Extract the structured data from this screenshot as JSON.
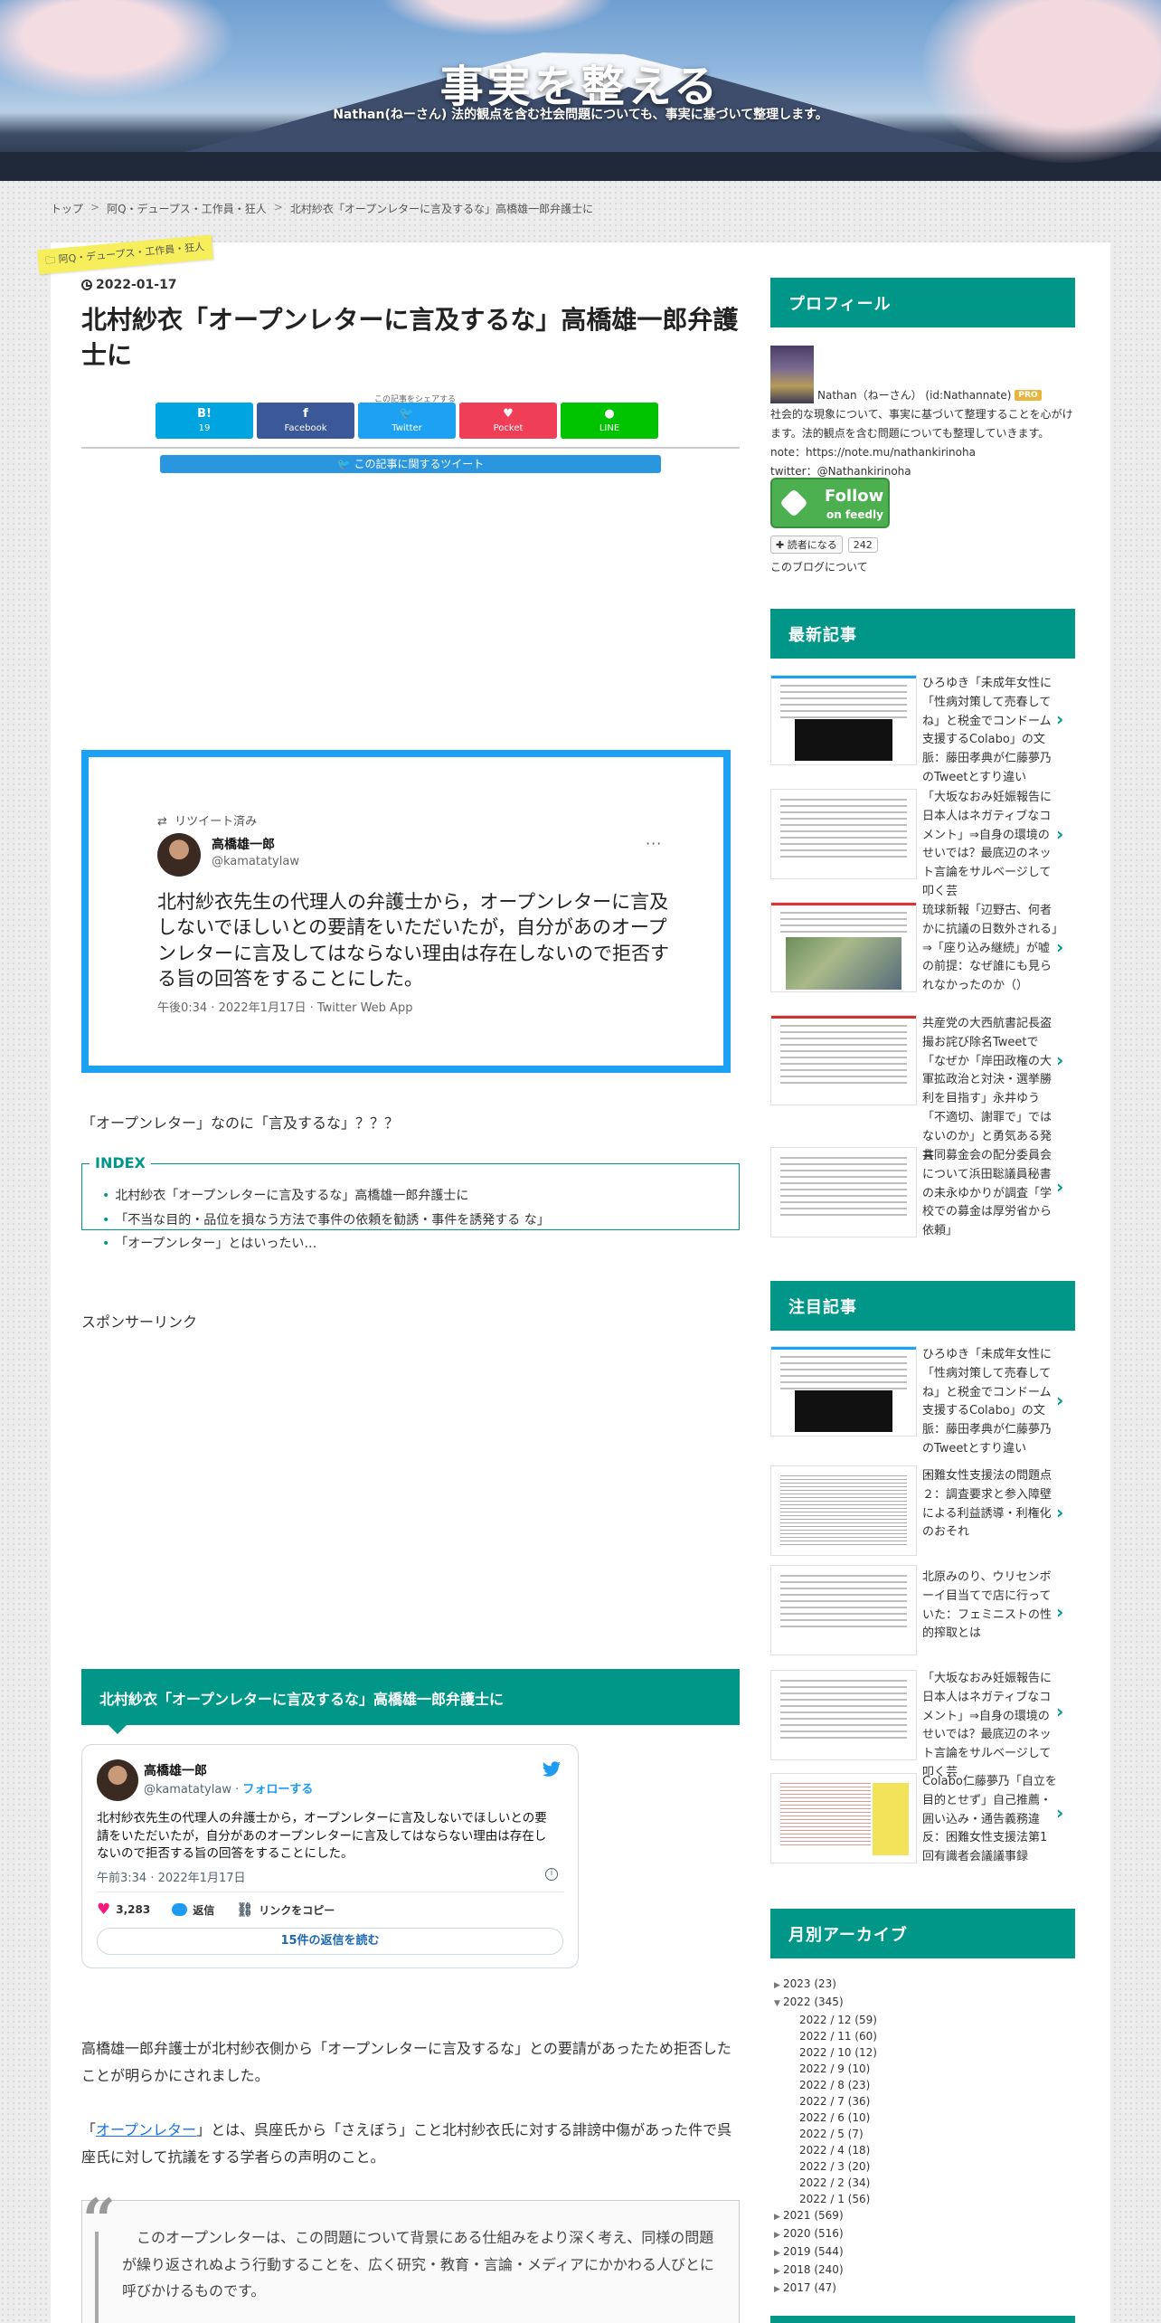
{
  "site": {
    "title": "事実を整える",
    "description": "Nathan(ねーさん) 法的観点を含む社会問題についても、事実に基づいて整理します。"
  },
  "breadcrumb": [
    "トップ",
    "阿Q・デュープス・工作員・狂人",
    "北村紗衣「オープンレターに言及するな」高橋雄一郎弁護士に"
  ],
  "post": {
    "category": "阿Q・デュープス・工作員・狂人",
    "date": "2022-01-17",
    "title": "北村紗衣「オープンレターに言及するな」高橋雄一郎弁護士に"
  },
  "share": {
    "caption": "この記事をシェアする",
    "buttons": [
      {
        "icon": "B!",
        "label": "19",
        "color": "#00a4de"
      },
      {
        "icon": "f",
        "label": "Facebook",
        "color": "#3b5998"
      },
      {
        "icon": "🐦",
        "label": "Twitter",
        "color": "#1da1f2"
      },
      {
        "icon": "♥",
        "label": "Pocket",
        "color": "#ef3f56"
      },
      {
        "icon": "●",
        "label": "LINE",
        "color": "#00c300"
      }
    ],
    "tweet_about": "この記事に関するツイート"
  },
  "tweet1": {
    "retweet": "リツイート済み",
    "name": "高橋雄一郎",
    "handle": "@kamatatylaw",
    "more": "···",
    "text": "北村紗衣先生の代理人の弁護士から，オープンレターに言及しないでほしいとの要請をいただいたが，自分があのオープンレターに言及してはならない理由は存在しないので拒否する旨の回答をすることにした。",
    "time": "午後0:34 · 2022年1月17日 · Twitter Web App"
  },
  "intro": "「オープンレター」なのに「言及するな」？？？",
  "index": {
    "title": "INDEX",
    "items": [
      "北村紗衣「オープンレターに言及するな」高橋雄一郎弁護士に",
      "「不当な目的・品位を損なう方法で事件の依頼を勧誘・事件を誘発する な」",
      "「オープンレター」とはいったい…"
    ]
  },
  "sponsor": "スポンサーリンク",
  "section1": "北村紗衣「オープンレターに言及するな」高橋雄一郎弁護士に",
  "embed": {
    "name": "高橋雄一郎",
    "handle": "@kamatatylaw",
    "follow": "フォローする",
    "text": "北村紗衣先生の代理人の弁護士から，オープンレターに言及しないでほしいとの要請をいただいたが，自分があのオープンレターに言及してはならない理由は存在しないので拒否する旨の回答をすることにした。",
    "time": "午前3:34 · 2022年1月17日",
    "likes": "3,283",
    "reply": "返信",
    "copy": "リンクをコピー",
    "replies": "15件の返信を読む"
  },
  "body": {
    "p1": "高橋雄一郎弁護士が北村紗衣側から「オープンレターに言及するな」との要請があったため拒否したことが明らかにされました。",
    "p2_pre": "「",
    "p2_link": "オープンレター",
    "p2_post": "」とは、呉座氏から「さえぼう」こと北村紗衣氏に対する誹謗中傷があった件で呉座氏に対して抗議をする学者らの声明のこと。",
    "quote": "このオープンレターは、この問題について背景にある仕組みをより深く考え、同様の問題が繰り返されぬよう行動することを、広く研究・教育・言論・メディアにかかわる人びとに呼びかけるものです。"
  },
  "sidebar": {
    "profile": {
      "head": "プロフィール",
      "name": "Nathan（ねーさん） (id:Nathannate)",
      "pro": "PRO",
      "bio": "社会的な現象について、事実に基づいて整理することを心がけます。法的観点を含む問題についても整理していきます。",
      "note": "note：https://note.mu/nathankirinoha",
      "twitter": "twitter：@Nathankirinoha",
      "feedly1": "Follow",
      "feedly2": "on feedly",
      "reader": "読者になる",
      "reader_count": "242",
      "about": "このブログについて"
    },
    "recent": {
      "head": "最新記事",
      "items": [
        "ひろゆき「未成年女性に「性病対策して売春してね」と税金でコンドーム支援するColabo」の文脈：藤田孝典が仁藤夢乃のTweetとすり違い",
        "「大坂なおみ妊娠報告に日本人はネガティブなコメント」⇒自身の環境のせいでは？最底辺のネット言論をサルベージして叩く芸",
        "琉球新報「辺野古、何者かに抗議の日数外される」⇒「座り込み継続」が嘘の前提：なぜ誰にも見られなかったのか（）",
        "共産党の大西航書記長盗撮お詫び除名Tweetで「なぜか「岸田政権の大軍拡政治と対決・選挙勝利を目指す」永井ゆう「不適切、謝罪で」ではないのか」と勇気ある発言",
        "共同募金会の配分委員会について浜田聡議員秘書の未永ゆかりが調査「学校での募金は厚労省から依頼」"
      ]
    },
    "featured": {
      "head": "注目記事",
      "items": [
        "ひろゆき「未成年女性に「性病対策して売春してね」と税金でコンドーム支援するColabo」の文脈：藤田孝典が仁藤夢乃のTweetとすり違い",
        "困難女性支援法の問題点２：調査要求と参入障壁による利益誘導・利権化のおそれ",
        "北原みのり、ウリセンボーイ目当てで店に行っていた：フェミニストの性的搾取とは",
        "「大坂なおみ妊娠報告に日本人はネガティブなコメント」⇒自身の環境のせいでは？最底辺のネット言論をサルベージして叩く芸",
        "Colabo仁藤夢乃「自立を目的とせず」自己推薦・囲い込み・通告義務違反：困難女性支援法第1回有識者会議議事録"
      ]
    },
    "archive": {
      "head": "月別アーカイブ",
      "years": [
        {
          "label": "2023 (23)",
          "open": false
        },
        {
          "label": "2022 (345)",
          "open": true
        }
      ],
      "months": [
        "2022 / 12 (59)",
        "2022 / 11 (60)",
        "2022 / 10 (12)",
        "2022 / 9 (10)",
        "2022 / 8 (23)",
        "2022 / 7 (36)",
        "2022 / 6 (10)",
        "2022 / 5 (7)",
        "2022 / 4 (18)",
        "2022 / 3 (20)",
        "2022 / 2 (34)",
        "2022 / 1 (56)"
      ],
      "older": [
        "2021 (569)",
        "2020 (516)",
        "2019 (544)",
        "2018 (240)",
        "2017 (47)"
      ]
    }
  }
}
